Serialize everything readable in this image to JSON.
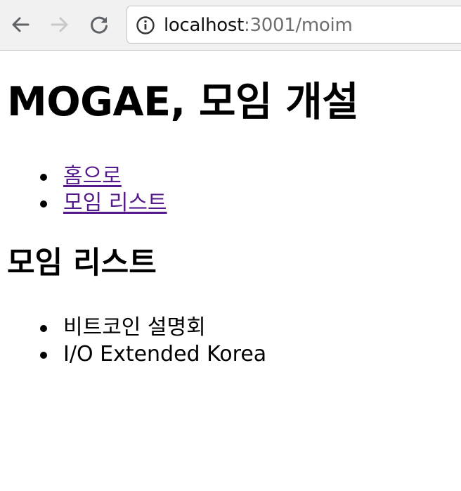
{
  "browser": {
    "url_host": "localhost",
    "url_rest": ":3001/moim",
    "icons": {
      "back": "arrow-left-icon",
      "forward": "arrow-right-icon",
      "reload": "reload-icon",
      "info": "info-icon"
    },
    "colors": {
      "toolbar_bg": "#f1f1f1",
      "icon_active": "#5f6368",
      "icon_disabled": "#c8c8c8"
    }
  },
  "page": {
    "title": "MOGAE, 모임 개설",
    "nav_links": [
      {
        "label": "홈으로"
      },
      {
        "label": "모임 리스트"
      }
    ],
    "section_title": "모임 리스트",
    "moims": [
      {
        "name": "비트코인 설명회"
      },
      {
        "name": "I/O Extended Korea"
      }
    ],
    "colors": {
      "visited_link": "#551a8b",
      "text": "#000000"
    }
  }
}
